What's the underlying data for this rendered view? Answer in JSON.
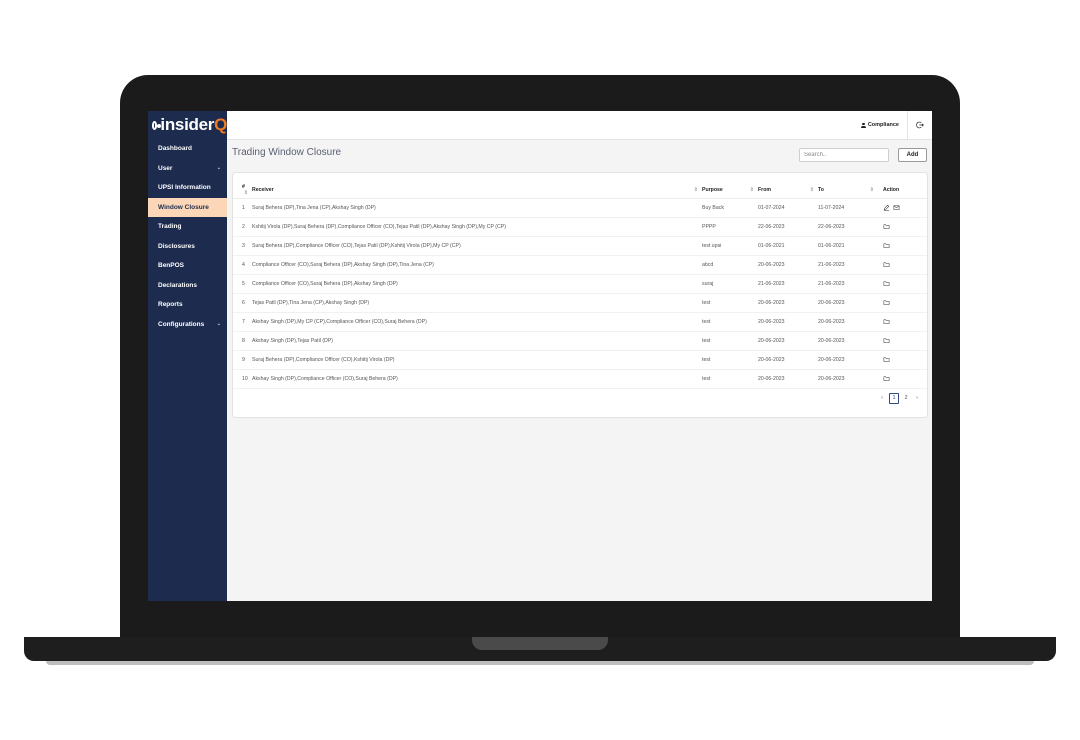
{
  "app": {
    "logo_text": "insider",
    "logo_accent": "Q"
  },
  "sidebar": {
    "items": [
      {
        "label": "Dashboard",
        "has_submenu": false,
        "active": false
      },
      {
        "label": "User",
        "has_submenu": true,
        "active": false
      },
      {
        "label": "UPSI Information",
        "has_submenu": false,
        "active": false
      },
      {
        "label": "Window Closure",
        "has_submenu": false,
        "active": true
      },
      {
        "label": "Trading",
        "has_submenu": false,
        "active": false
      },
      {
        "label": "Disclosures",
        "has_submenu": false,
        "active": false
      },
      {
        "label": "BenPOS",
        "has_submenu": false,
        "active": false
      },
      {
        "label": "Declarations",
        "has_submenu": false,
        "active": false
      },
      {
        "label": "Reports",
        "has_submenu": false,
        "active": false
      },
      {
        "label": "Configurations",
        "has_submenu": true,
        "active": false
      }
    ]
  },
  "topbar": {
    "user_label": "Compliance",
    "user_icon": "person-icon",
    "logout_icon": "logout-icon"
  },
  "page": {
    "title": "Trading Window Closure",
    "search_placeholder": "Search..",
    "add_label": "Add"
  },
  "table": {
    "columns": [
      "#",
      "Receiver",
      "Purpose",
      "From",
      "To",
      "Action"
    ],
    "rows": [
      {
        "num": "1",
        "receiver": "Suraj Behera (DP),Tina Jena (CP),Akshay Singh (DP)",
        "purpose": "Buy Back",
        "from": "01-07-2024",
        "to": "11-07-2024",
        "actions": [
          "edit-icon",
          "mail-icon"
        ]
      },
      {
        "num": "2",
        "receiver": "Kshitij Virola (DP),Suraj Behera (DP),Compliance Officer (CO),Tejas Patil (DP),Akshay Singh (DP),My CP (CP)",
        "purpose": "PPPP",
        "from": "22-06-2023",
        "to": "22-06-2023",
        "actions": [
          "folder-icon"
        ]
      },
      {
        "num": "3",
        "receiver": "Suraj Behera (DP),Compliance Officer (CO),Tejas Patil (DP),Kshitij Virola (DP),My CP (CP)",
        "purpose": "test upsi",
        "from": "01-06-2021",
        "to": "01-06-2021",
        "actions": [
          "folder-icon"
        ]
      },
      {
        "num": "4",
        "receiver": "Compliance Officer (CO),Suraj Behera (DP),Akshay Singh (DP),Tina Jena (CP)",
        "purpose": "abcd",
        "from": "20-06-2023",
        "to": "21-06-2023",
        "actions": [
          "folder-icon"
        ]
      },
      {
        "num": "5",
        "receiver": "Compliance Officer (CO),Suraj Behera (DP),Akshay Singh (DP)",
        "purpose": "suraj",
        "from": "21-06-2023",
        "to": "21-06-2023",
        "actions": [
          "folder-icon"
        ]
      },
      {
        "num": "6",
        "receiver": "Tejas Patil (DP),Tina Jena (CP),Akshay Singh (DP)",
        "purpose": "test",
        "from": "20-06-2023",
        "to": "20-06-2023",
        "actions": [
          "folder-icon"
        ]
      },
      {
        "num": "7",
        "receiver": "Akshay Singh (DP),My CP (CP),Compliance Officer (CO),Suraj Behera (DP)",
        "purpose": "test",
        "from": "20-06-2023",
        "to": "20-06-2023",
        "actions": [
          "folder-icon"
        ]
      },
      {
        "num": "8",
        "receiver": "Akshay Singh (DP),Tejas Patil (DP)",
        "purpose": "test",
        "from": "20-06-2023",
        "to": "20-06-2023",
        "actions": [
          "folder-icon"
        ]
      },
      {
        "num": "9",
        "receiver": "Suraj Behera (DP),Compliance Officer (CO),Kshitij Virola (DP)",
        "purpose": "test",
        "from": "20-06-2023",
        "to": "20-06-2023",
        "actions": [
          "folder-icon"
        ]
      },
      {
        "num": "10",
        "receiver": "Akshay Singh (DP),Compliance Officer (CO),Suraj Behera (DP)",
        "purpose": "test",
        "from": "20-06-2023",
        "to": "20-06-2023",
        "actions": [
          "folder-icon"
        ]
      }
    ]
  },
  "pagination": {
    "prev": "‹",
    "pages": [
      "1",
      "2"
    ],
    "current": "1",
    "next": "›"
  },
  "colors": {
    "sidebar_bg": "#1c2b4e",
    "active_item_bg": "#fbd7b7",
    "logo_accent": "#f07c22",
    "pager_accent": "#2e4b86"
  }
}
